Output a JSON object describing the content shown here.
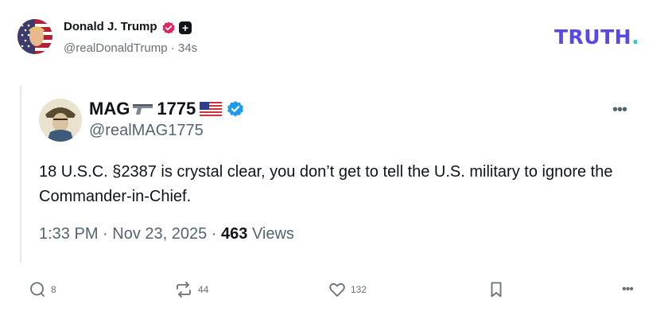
{
  "post": {
    "author_name": "Donald J. Trump",
    "handle": "@realDonaldTrump",
    "separator": "·",
    "time_ago": "34s"
  },
  "brand": {
    "logo_text": "TRUTH",
    "logo_dot": ".",
    "logo_color": "#5848e8",
    "dot_color": "#2ec7c7"
  },
  "quoted": {
    "name_prefix": "MAG",
    "name_suffix": "1775",
    "handle": "@realMAG1775",
    "more_label": "•••",
    "text": "18 U.S.C. §2387 is crystal clear, you don’t get to tell the U.S. military to ignore the Commander-in-Chief.",
    "time": "1:33 PM · Nov 23, 2025 · ",
    "views_count": "463",
    "views_label": " Views"
  },
  "actions": {
    "replies": "8",
    "retruths": "44",
    "likes": "132",
    "more_label": "•••"
  },
  "colors": {
    "verified": "#e0245e",
    "x_verified": "#1d9bf0"
  }
}
